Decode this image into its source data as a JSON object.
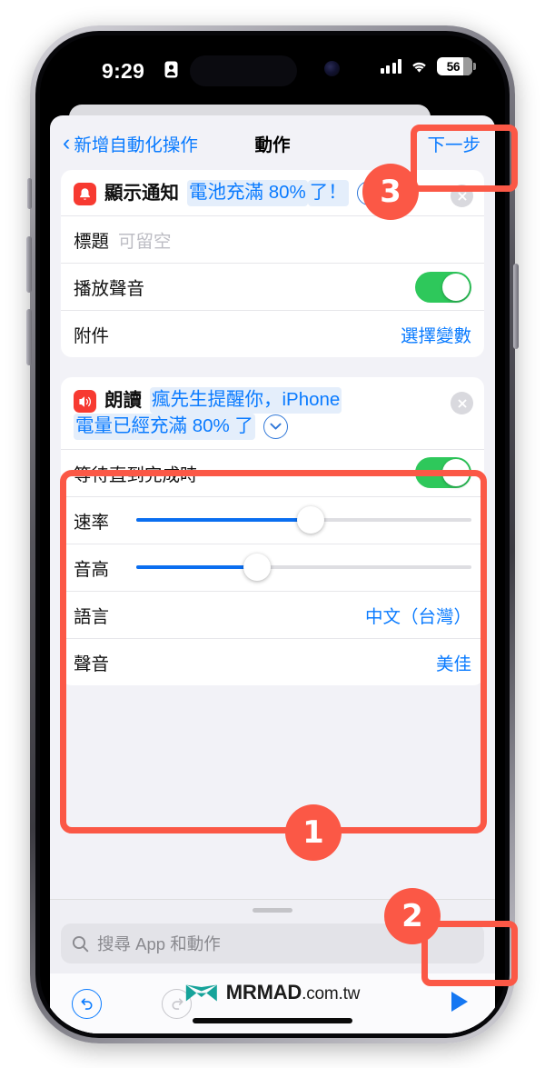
{
  "status_bar": {
    "time": "9:29",
    "lock_icon": "person-lock-icon",
    "signal_icon": "cellular-signal-icon",
    "wifi_icon": "wifi-icon",
    "battery_percent": "56"
  },
  "nav": {
    "back_label": "新增自動化操作",
    "back_chevron": "‹",
    "title": "動作",
    "next_label": "下一步"
  },
  "cards": [
    {
      "icon_name": "notification-bell-icon",
      "action_name": "顯示通知",
      "tokens": [
        "電池充滿 80%",
        "了！"
      ],
      "expand_icon": "chevron-down-icon",
      "close_icon": "close-icon",
      "rows": [
        {
          "label": "標題",
          "placeholder": "可留空",
          "type": "text"
        },
        {
          "label": "播放聲音",
          "type": "toggle",
          "value": "on"
        },
        {
          "label": "附件",
          "type": "value",
          "value": "選擇變數"
        }
      ]
    },
    {
      "icon_name": "speaker-wave-icon",
      "action_name": "朗讀",
      "tokens": [
        "瘋先生提醒你，iPhone",
        "電量已經充滿 80% 了"
      ],
      "expand_icon": "chevron-down-icon",
      "close_icon": "close-icon",
      "rows": [
        {
          "label": "等待直到完成時",
          "type": "toggle",
          "value": "on"
        },
        {
          "label": "速率",
          "type": "slider",
          "percent": 52
        },
        {
          "label": "音高",
          "type": "slider",
          "percent": 36
        },
        {
          "label": "語言",
          "type": "value",
          "value": "中文（台灣）"
        },
        {
          "label": "聲音",
          "type": "value",
          "value": "美佳"
        }
      ]
    }
  ],
  "search": {
    "icon": "search-icon",
    "placeholder": "搜尋 App 和動作"
  },
  "toolbar": {
    "undo_icon": "undo-icon",
    "redo_icon": "redo-icon",
    "play_icon": "play-icon"
  },
  "watermark": {
    "logo_icon": "mrmad-logo-icon",
    "brand": "MRMAD",
    "domain": ".com.tw"
  },
  "annotations": [
    {
      "number": "1",
      "target": "speak-text-card"
    },
    {
      "number": "2",
      "target": "play-button"
    },
    {
      "number": "3",
      "target": "next-button"
    }
  ],
  "colors": {
    "accent_blue": "#0a7bff",
    "annotation_red": "#fb5846",
    "toggle_green": "#2ec85b",
    "app_icon_red": "#f73a31",
    "logo_teal": "#16a39a"
  }
}
